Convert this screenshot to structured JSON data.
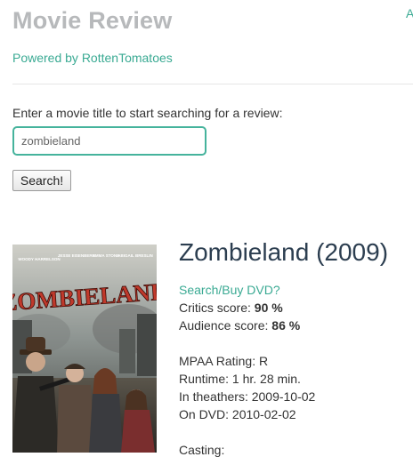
{
  "header": {
    "title": "Movie Review",
    "powered_by": "Powered by RottenTomatoes",
    "corner_link": "A"
  },
  "search": {
    "prompt": "Enter a movie title to start searching for a review:",
    "value": "zombieland",
    "button_label": "Search!"
  },
  "movie": {
    "title": "Zombieland (2009)",
    "buy_link": "Search/Buy DVD?",
    "critics_label": "Critics score: ",
    "critics_score": "90 %",
    "audience_label": "Audience score: ",
    "audience_score": "86 %",
    "mpaa": "MPAA Rating: R",
    "runtime": "Runtime: 1 hr. 28 min.",
    "theaters": "In theathers: 2009-10-02",
    "dvd": "On DVD: 2010-02-02",
    "casting_label": "Casting:",
    "poster": {
      "title_text": "ZOMBIELAND",
      "cast_names": [
        "WOODY HARRELSON",
        "JESSE EISENBERG",
        "EMMA STONE",
        "ABIGAIL BRESLIN"
      ]
    }
  },
  "colors": {
    "accent": "#3aaa93",
    "title_gray": "#b7b9bb",
    "movie_title": "#2c3e50",
    "poster_title": "#c0392b"
  }
}
